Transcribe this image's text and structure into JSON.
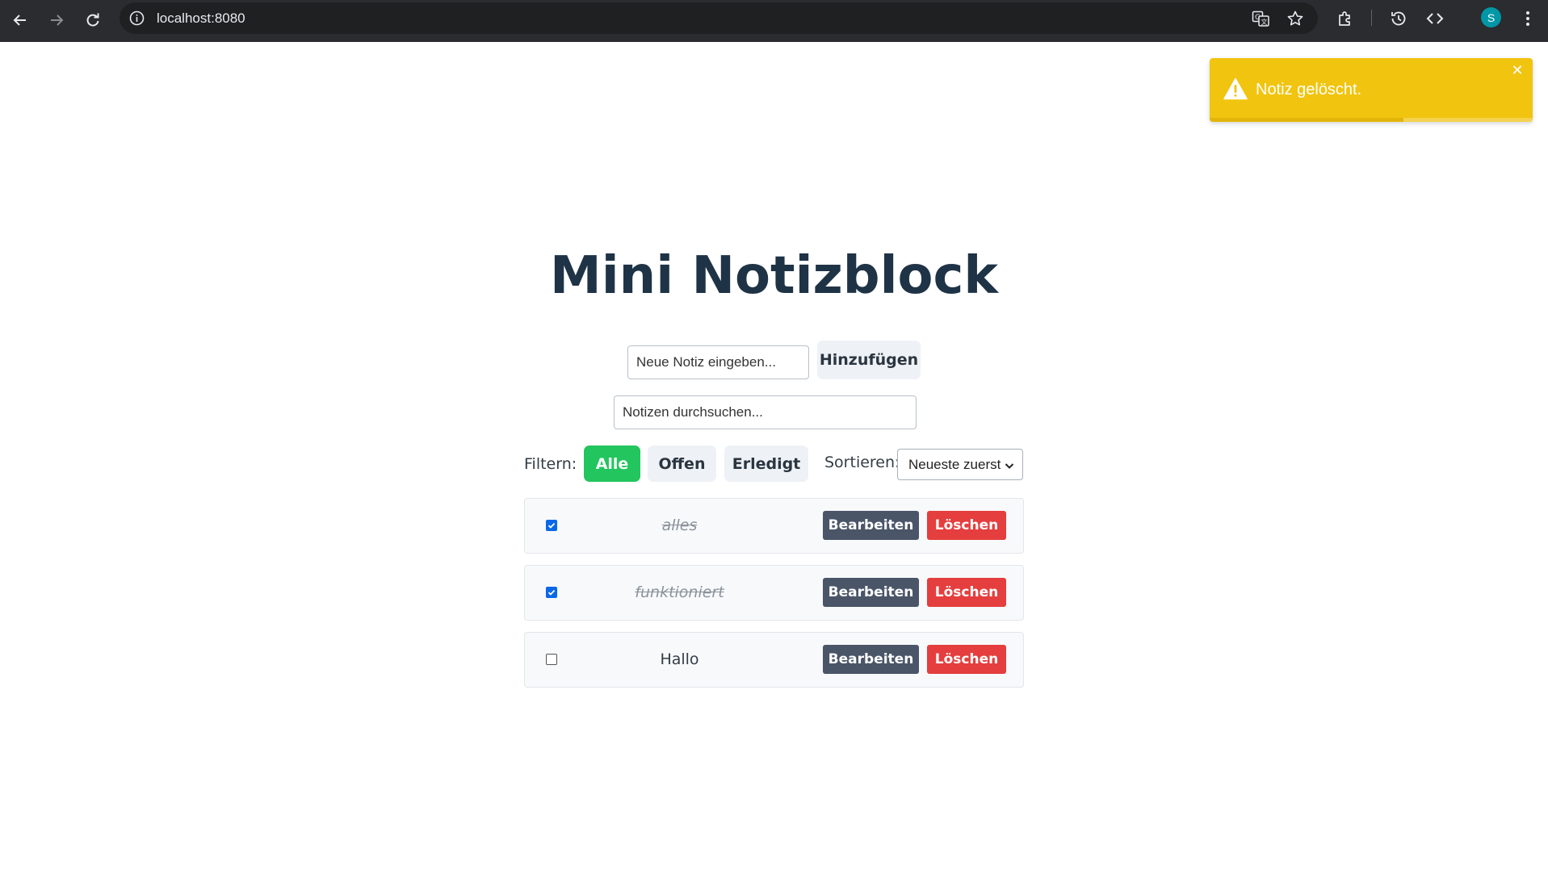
{
  "browser": {
    "url": "localhost:8080",
    "profile_initial": "S",
    "icons": [
      "back-icon",
      "forward-icon",
      "reload-icon",
      "site-info-icon",
      "translate-icon",
      "star-icon",
      "extensions-icon",
      "history-icon",
      "devtools-icon",
      "menu-icon"
    ]
  },
  "toast": {
    "message": "Notiz gelöscht.",
    "close_label": "✕",
    "color": "#f1c40f",
    "progress": 0.6
  },
  "app": {
    "title": "Mini Notizblock",
    "new_note_placeholder": "Neue Notiz eingeben...",
    "add_label": "Hinzufügen",
    "search_placeholder": "Notizen durchsuchen...",
    "filter_label": "Filtern:",
    "filters": [
      "Alle",
      "Offen",
      "Erledigt"
    ],
    "active_filter": "Alle",
    "sort_label": "Sortieren:",
    "sort_value": "Neueste zuerst",
    "accent_color": "#22c55e"
  },
  "notes": [
    {
      "text": "alles",
      "done": true,
      "edit_label": "Bearbeiten",
      "delete_label": "Löschen"
    },
    {
      "text": "funktioniert",
      "done": true,
      "edit_label": "Bearbeiten",
      "delete_label": "Löschen"
    },
    {
      "text": "Hallo",
      "done": false,
      "edit_label": "Bearbeiten",
      "delete_label": "Löschen"
    }
  ]
}
